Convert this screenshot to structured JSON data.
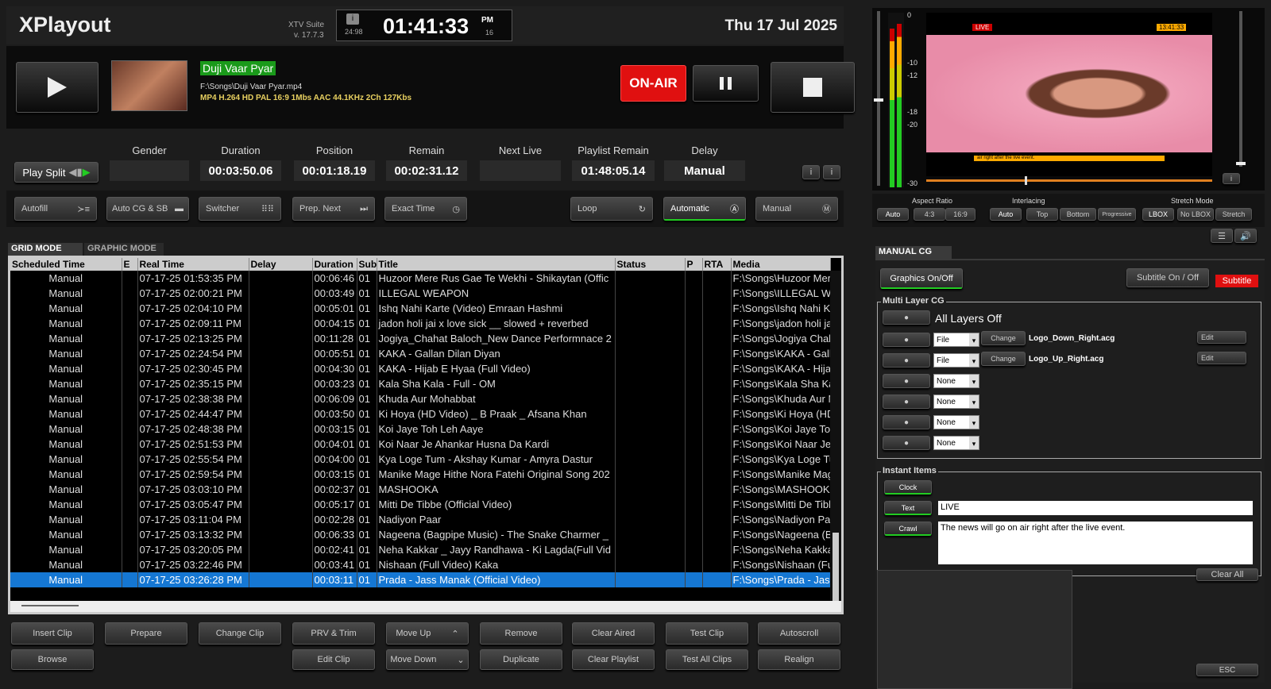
{
  "app": {
    "title": "XPlayout",
    "suite": "XTV Suite",
    "version": "v. 17.7.3",
    "clock": "01:41:33",
    "ampm": "PM",
    "fps": "24:98",
    "fps2": "16",
    "date": "Thu 17 Jul 2025"
  },
  "player": {
    "clip_title": "Duji Vaar Pyar",
    "path": "F:\\Songs\\Duji Vaar Pyar.mp4",
    "info": "MP4 H.264 HD PAL 16:9 1Mbs AAC 44.1KHz 2Ch 127Kbs",
    "on_air": "ON-AIR"
  },
  "stats": {
    "play_split": "Play Split",
    "labels": [
      "Gender",
      "Duration",
      "Position",
      "Remain",
      "Next Live",
      "Playlist Remain",
      "Delay"
    ],
    "values": [
      "",
      "00:03:50.06",
      "00:01:18.19",
      "00:02:31.12",
      "",
      "01:48:05.14",
      "Manual"
    ]
  },
  "toolbar": {
    "autofill": "Autofill",
    "autocg": "Auto CG & SB",
    "switcher": "Switcher",
    "prep_next": "Prep. Next",
    "exact_time": "Exact Time",
    "loop": "Loop",
    "automatic": "Automatic",
    "manual": "Manual"
  },
  "tabs": {
    "grid": "GRID MODE",
    "graphic": "GRAPHIC MODE"
  },
  "grid": {
    "columns": [
      "Scheduled Time",
      "E",
      "Real Time",
      "Delay",
      "Duration",
      "Sub",
      "Title",
      "Status",
      "P",
      "RTA",
      "Media"
    ],
    "rows": [
      [
        "Manual",
        "07-17-25  01:53:35 PM",
        "00:06:46",
        "01",
        "Huzoor Mere Rus Gae Te Wekhi - Shikaytan (Offic",
        "F:\\Songs\\Huzoor Mere"
      ],
      [
        "Manual",
        "07-17-25  02:00:21 PM",
        "00:03:49",
        "01",
        "ILLEGAL WEAPON",
        "F:\\Songs\\ILLEGAL W"
      ],
      [
        "Manual",
        "07-17-25  02:04:10 PM",
        "00:05:01",
        "01",
        "Ishq Nahi Karte (Video) Emraan Hashmi",
        "F:\\Songs\\Ishq Nahi Ka"
      ],
      [
        "Manual",
        "07-17-25  02:09:11 PM",
        "00:04:15",
        "01",
        "jadon holi jai x love sick __ slowed + reverbed",
        "F:\\Songs\\jadon holi jai"
      ],
      [
        "Manual",
        "07-17-25  02:13:25 PM",
        "00:11:28",
        "01",
        "Jogiya_Chahat Baloch_New Dance Performnace 2",
        "F:\\Songs\\Jogiya Chah"
      ],
      [
        "Manual",
        "07-17-25  02:24:54 PM",
        "00:05:51",
        "01",
        "KAKA - Gallan Dilan Diyan",
        "F:\\Songs\\KAKA - Galla"
      ],
      [
        "Manual",
        "07-17-25  02:30:45 PM",
        "00:04:30",
        "01",
        "KAKA - Hijab E Hyaa (Full Video)",
        "F:\\Songs\\KAKA - Hijab"
      ],
      [
        "Manual",
        "07-17-25  02:35:15 PM",
        "00:03:23",
        "01",
        "Kala Sha Kala - Full - OM",
        "F:\\Songs\\Kala Sha Ka"
      ],
      [
        "Manual",
        "07-17-25  02:38:38 PM",
        "00:06:09",
        "01",
        "Khuda Aur Mohabbat",
        "F:\\Songs\\Khuda Aur M"
      ],
      [
        "Manual",
        "07-17-25  02:44:47 PM",
        "00:03:50",
        "01",
        "Ki Hoya (HD Video) _ B Praak _ Afsana Khan",
        "F:\\Songs\\Ki Hoya (HD"
      ],
      [
        "Manual",
        "07-17-25  02:48:38 PM",
        "00:03:15",
        "01",
        "Koi Jaye Toh Leh Aaye",
        "F:\\Songs\\Koi Jaye Toh"
      ],
      [
        "Manual",
        "07-17-25  02:51:53 PM",
        "00:04:01",
        "01",
        "Koi Naar Je Ahankar Husna Da Kardi",
        "F:\\Songs\\Koi Naar Je A"
      ],
      [
        "Manual",
        "07-17-25  02:55:54 PM",
        "00:04:00",
        "01",
        "Kya Loge Tum - Akshay Kumar - Amyra Dastur",
        "F:\\Songs\\Kya Loge Tu"
      ],
      [
        "Manual",
        "07-17-25  02:59:54 PM",
        "00:03:15",
        "01",
        "Manike Mage Hithe Nora Fatehi Original Song 202",
        "F:\\Songs\\Manike Mag"
      ],
      [
        "Manual",
        "07-17-25  03:03:10 PM",
        "00:02:37",
        "01",
        "MASHOOKA",
        "F:\\Songs\\MASHOOKA"
      ],
      [
        "Manual",
        "07-17-25  03:05:47 PM",
        "00:05:17",
        "01",
        "Mitti De Tibbe (Official Video)",
        "F:\\Songs\\Mitti De Tibb"
      ],
      [
        "Manual",
        "07-17-25  03:11:04 PM",
        "00:02:28",
        "01",
        "Nadiyon Paar",
        "F:\\Songs\\Nadiyon Paa"
      ],
      [
        "Manual",
        "07-17-25  03:13:32 PM",
        "00:06:33",
        "01",
        "Nageena (Bagpipe Music) - The Snake Charmer _",
        "F:\\Songs\\Nageena (B"
      ],
      [
        "Manual",
        "07-17-25  03:20:05 PM",
        "00:02:41",
        "01",
        "Neha Kakkar _ Jayy Randhawa - Ki Lagda(Full Vid",
        "F:\\Songs\\Neha Kakka"
      ],
      [
        "Manual",
        "07-17-25  03:22:46 PM",
        "00:03:41",
        "01",
        "Nishaan (Full Video) Kaka",
        "F:\\Songs\\Nishaan (Fu"
      ],
      [
        "Manual",
        "07-17-25  03:26:28 PM",
        "00:03:11",
        "01",
        "Prada - Jass Manak (Official Video)",
        "F:\\Songs\\Prada - Jass"
      ]
    ],
    "selected_index": 20
  },
  "bottom_buttons": {
    "row1": [
      "Insert Clip",
      "Prepare",
      "Change Clip",
      "PRV & Trim",
      "Move Up",
      "Remove",
      "Clear Aired",
      "Test Clip",
      "Autoscroll"
    ],
    "row2": [
      "Browse",
      "",
      "",
      "Edit Clip",
      "Move Down",
      "Duplicate",
      "Clear Playlist",
      "Test All Clips",
      "Realign"
    ]
  },
  "preview": {
    "live_tag": "LIVE",
    "time_tag": "13:41:33",
    "crawl_text": "air right after the live event.",
    "meter_labels": [
      "0",
      "-10",
      "-12",
      "-18",
      "-20",
      "-30"
    ],
    "meter_ticks": [
      "0",
      "-10",
      "-12",
      "-18",
      "-20",
      "-30"
    ]
  },
  "video_settings": {
    "aspect_label": "Aspect Ratio",
    "aspect": [
      "Auto",
      "4:3",
      "16:9"
    ],
    "interlace_label": "Interlacing",
    "interlace": [
      "Auto",
      "Top",
      "Bottom",
      "Progressive"
    ],
    "stretch_label": "Stretch Mode",
    "stretch": [
      "LBOX",
      "No LBOX",
      "Stretch"
    ]
  },
  "cg": {
    "tab": "MANUAL CG",
    "graphics_onoff": "Graphics On/Off",
    "subtitle_onoff": "Subtitle On / Off",
    "subtitle": "Subtitle",
    "multi_layer_label": "Multi Layer CG",
    "all_layers_off": "All Layers Off",
    "layers": [
      {
        "type": "File",
        "change": "Change",
        "file": "Logo_Down_Right.acg",
        "edit": "Edit"
      },
      {
        "type": "File",
        "change": "Change",
        "file": "Logo_Up_Right.acg",
        "edit": "Edit"
      },
      {
        "type": "None"
      },
      {
        "type": "None"
      },
      {
        "type": "None"
      },
      {
        "type": "None"
      }
    ],
    "instant_label": "Instant Items",
    "clock": "Clock",
    "text_btn": "Text",
    "text_value": "LIVE",
    "crawl_btn": "Crawl",
    "crawl_value": "The news will go on air right after the live event.",
    "clear_all": "Clear All",
    "esc": "ESC"
  },
  "colors": {
    "on_air": "#e01010",
    "selected_row": "#1577d3",
    "clip_title_bg": "#1a9a1a",
    "subtitle": "#e01010"
  }
}
